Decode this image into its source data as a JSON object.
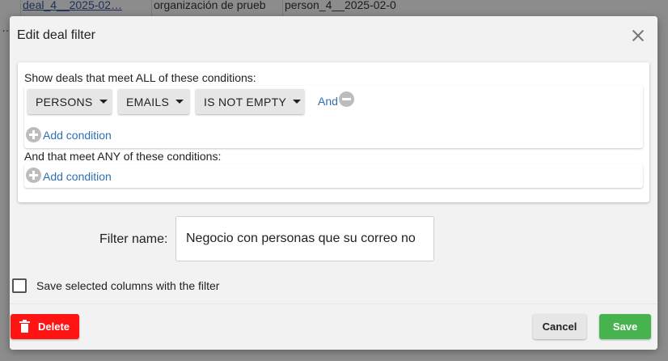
{
  "background_table": {
    "row1": [
      "",
      "deal_4__2025-02…",
      "organización de prueb",
      "person_4__2025-02-0"
    ],
    "row2": [
      "…",
      "",
      "",
      ""
    ]
  },
  "dialog": {
    "title": "Edit deal filter",
    "all_label": "Show deals that meet ALL of these conditions:",
    "condition": {
      "field": "PERSONS",
      "subfield": "EMAILS",
      "operator": "IS NOT EMPTY",
      "and_label": "And"
    },
    "add_condition_label": "Add condition",
    "any_label": "And that meet ANY of these conditions:",
    "filter_name_label": "Filter name:",
    "filter_name_value": "Negocio con personas que su correo no",
    "save_columns_label": "Save selected columns with the filter",
    "save_columns_checked": false,
    "buttons": {
      "delete": "Delete",
      "cancel": "Cancel",
      "save": "Save"
    }
  },
  "colors": {
    "link": "#2f6fb5",
    "delete": "#ff1414",
    "save": "#46b34f"
  }
}
